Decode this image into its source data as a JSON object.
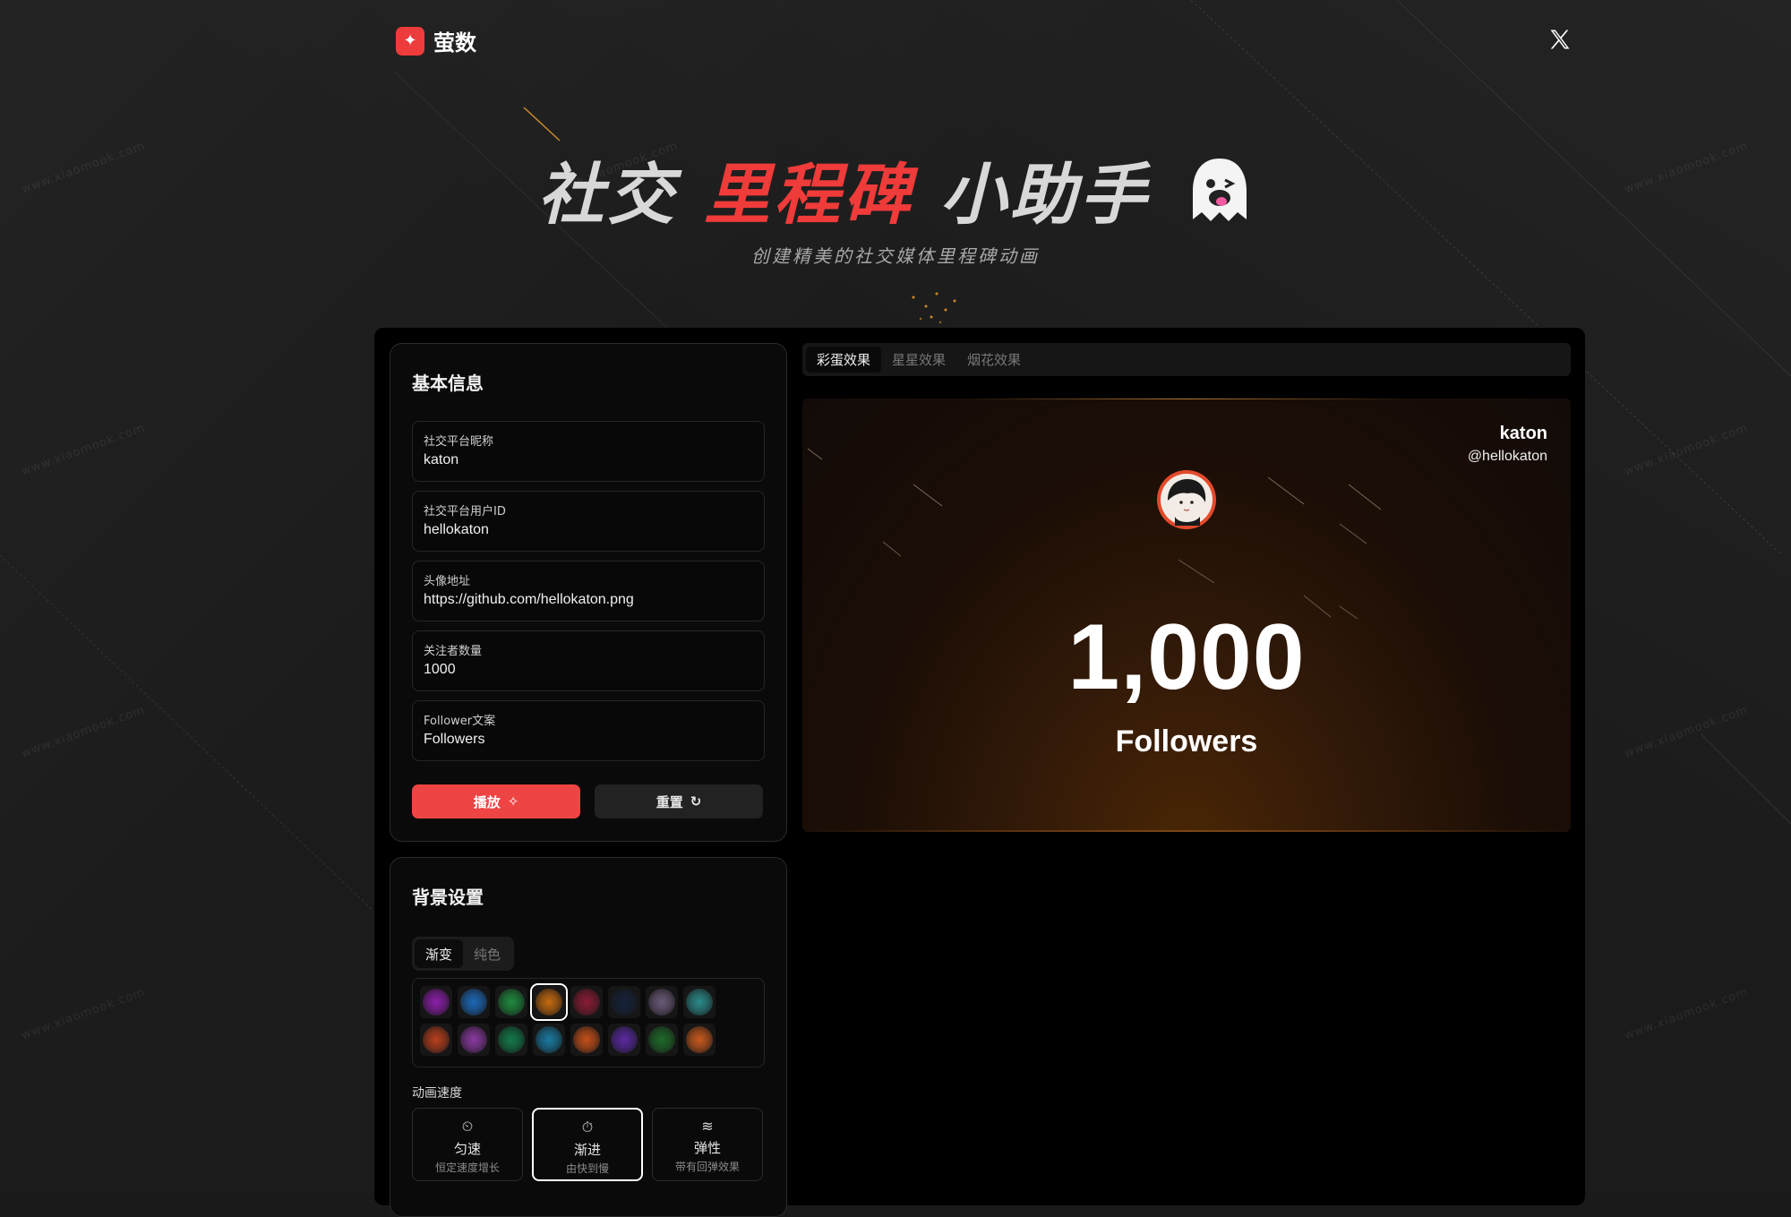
{
  "app": {
    "name": "萤数",
    "logo_icon": "sparkle-icon"
  },
  "header": {
    "x_icon": "x-logo-icon"
  },
  "hero": {
    "title_part1": "社交",
    "title_accent": "里程碑",
    "title_part2": "小助手",
    "emoji_icon": "ghost-icon",
    "subtitle": "创建精美的社交媒体里程碑动画"
  },
  "basic_info": {
    "title": "基本信息",
    "fields": [
      {
        "label": "社交平台昵称",
        "value": "katon"
      },
      {
        "label": "社交平台用户ID",
        "value": "hellokaton"
      },
      {
        "label": "头像地址",
        "value": "https://github.com/hellokaton.png"
      },
      {
        "label": "关注者数量",
        "value": "1000"
      },
      {
        "label": "Follower文案",
        "value": "Followers"
      }
    ],
    "play_label": "播放",
    "reset_label": "重置"
  },
  "background": {
    "title": "背景设置",
    "mode_tabs": [
      "渐变",
      "纯色"
    ],
    "active_mode": "渐变",
    "swatches": [
      "#8b1fa8",
      "#1d69b8",
      "#1f8a3e",
      "#c46a10",
      "#8a1c35",
      "#16223a",
      "#6a5a78",
      "#2c8a8a",
      "#b8401e",
      "#8a3aa0",
      "#137a4a",
      "#1a7aa0",
      "#c4501a",
      "#5a2aa0",
      "#1f6a2a",
      "#c85a1e"
    ],
    "selected_swatch": 3,
    "speed_label": "动画速度",
    "speed_options": [
      {
        "icon": "timer-off-icon",
        "name": "匀速",
        "desc": "恒定速度增长"
      },
      {
        "icon": "stopwatch-icon",
        "name": "渐进",
        "desc": "由快到慢"
      },
      {
        "icon": "waves-icon",
        "name": "弹性",
        "desc": "带有回弹效果"
      }
    ],
    "selected_speed": 1
  },
  "preview": {
    "tabs": [
      "彩蛋效果",
      "星星效果",
      "烟花效果"
    ],
    "active_tab": "彩蛋效果",
    "name": "katon",
    "handle": "@hellokaton",
    "count": "1,000",
    "label": "Followers"
  },
  "watermark": "www.xiaomook.com"
}
